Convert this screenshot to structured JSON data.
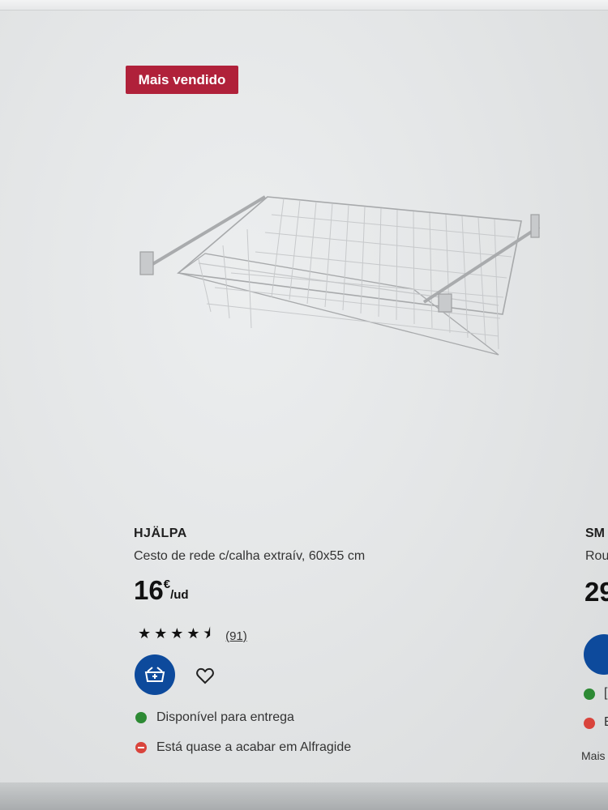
{
  "badge": "Mais vendido",
  "product": {
    "brand": "HJÄLPA",
    "description": "Cesto de rede c/calha extraív, 60x55 cm",
    "price_integer": "16",
    "price_currency": "€",
    "price_unit": "/ud",
    "rating_stars": 4.5,
    "review_count": "(91)"
  },
  "availability": {
    "delivery": "Disponível para entrega",
    "store": "Está quase a acabar em Alfragide"
  },
  "next_product": {
    "brand": "SM",
    "description": "Rou",
    "price": "29",
    "delivery_fragment": "[",
    "store_fragment": "E",
    "more": "Mais"
  },
  "icons": [
    "add-to-cart-icon",
    "heart-icon",
    "star-icon",
    "in-stock-dot",
    "low-stock-dot"
  ],
  "colors": {
    "badge_bg": "#b0213a",
    "cart_button": "#0d4a9c",
    "in_stock": "#2d8a34",
    "low_stock": "#d9443c"
  }
}
